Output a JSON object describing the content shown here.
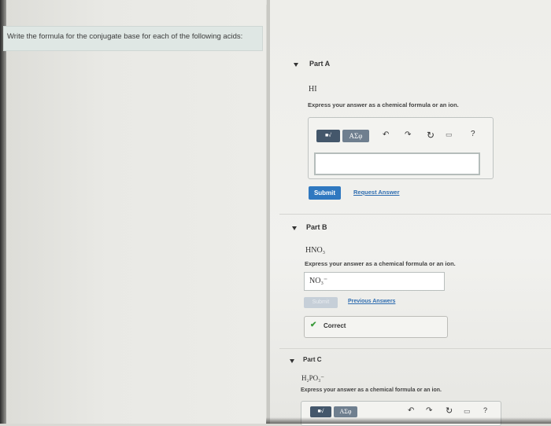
{
  "prompt": "Write the formula for the conjugate base for each of the following acids:",
  "partA": {
    "title": "Part A",
    "formula": "HI",
    "instruction": "Express your answer as a chemical formula or an ion.",
    "toolbar": {
      "greek": "ΑΣφ",
      "help": "?"
    },
    "answer": "",
    "submit": "Submit",
    "request": "Request Answer"
  },
  "partB": {
    "title": "Part B",
    "formula": "HNO₃",
    "instruction": "Express your answer as a chemical formula or an ion.",
    "answer": "NO₃⁻",
    "submit": "Submit",
    "previous": "Previous Answers",
    "correct": "Correct"
  },
  "partC": {
    "title": "Part C",
    "formula": "H₂PO₃⁻",
    "instruction": "Express your answer as a chemical formula or an ion.",
    "toolbar": {
      "greek": "ΑΣφ",
      "help": "?"
    }
  },
  "colors": {
    "accent": "#2f78c0",
    "correct": "#3a9a3a",
    "toolbar": "#44576b"
  }
}
